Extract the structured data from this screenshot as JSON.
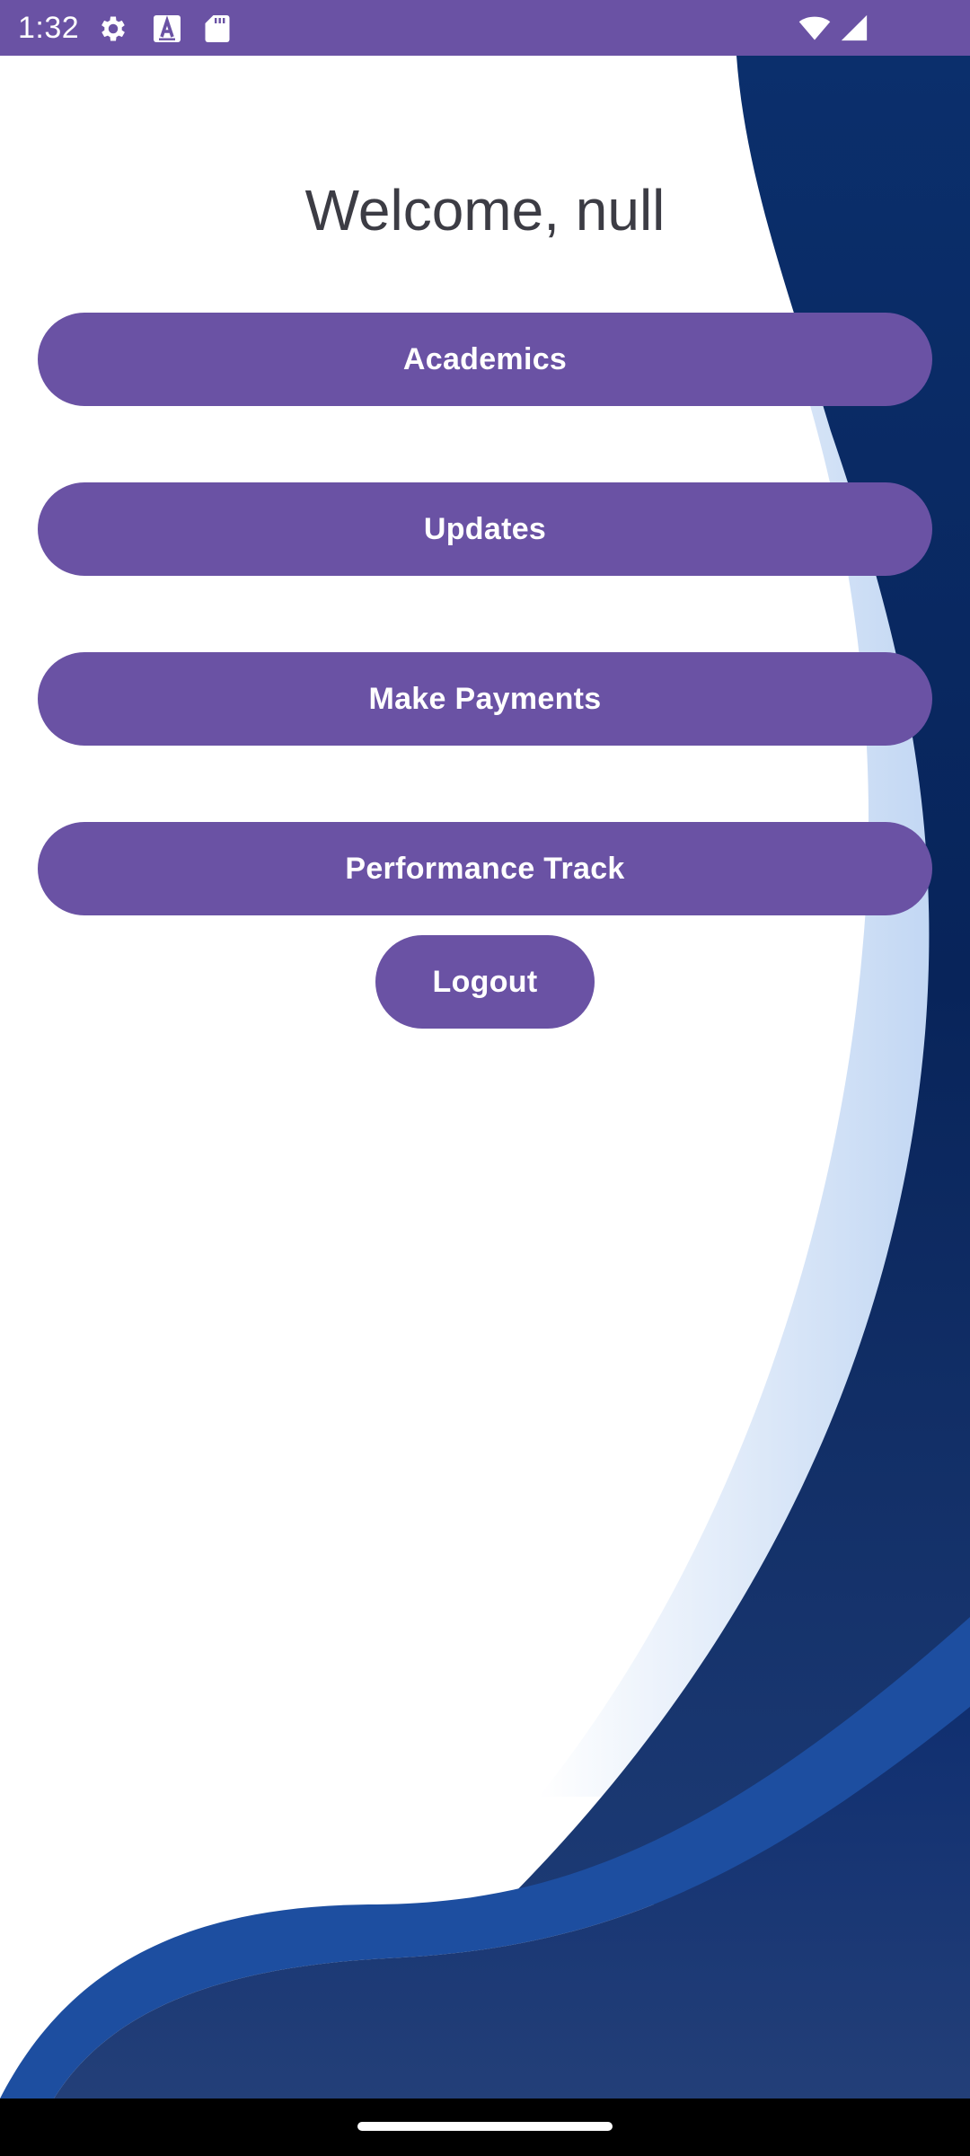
{
  "status_bar": {
    "time": "1:32",
    "icons": [
      "gear-icon",
      "a-text-icon",
      "sd-card-icon",
      "wifi-icon",
      "cell-signal-icon"
    ],
    "color": "#6a52a4"
  },
  "main": {
    "title": "Welcome, null",
    "buttons": {
      "academics": "Academics",
      "updates": "Updates",
      "make_payments": "Make Payments",
      "performance_track": "Performance Track",
      "logout": "Logout"
    }
  },
  "colors": {
    "accent": "#6a52a4",
    "wave_dark": "#0a2a66",
    "wave_mid": "#14418e",
    "wave_light": "#c9dcf4",
    "nav_bar": "#000000"
  },
  "nav_bar": {
    "handle": "home-gesture-handle"
  }
}
